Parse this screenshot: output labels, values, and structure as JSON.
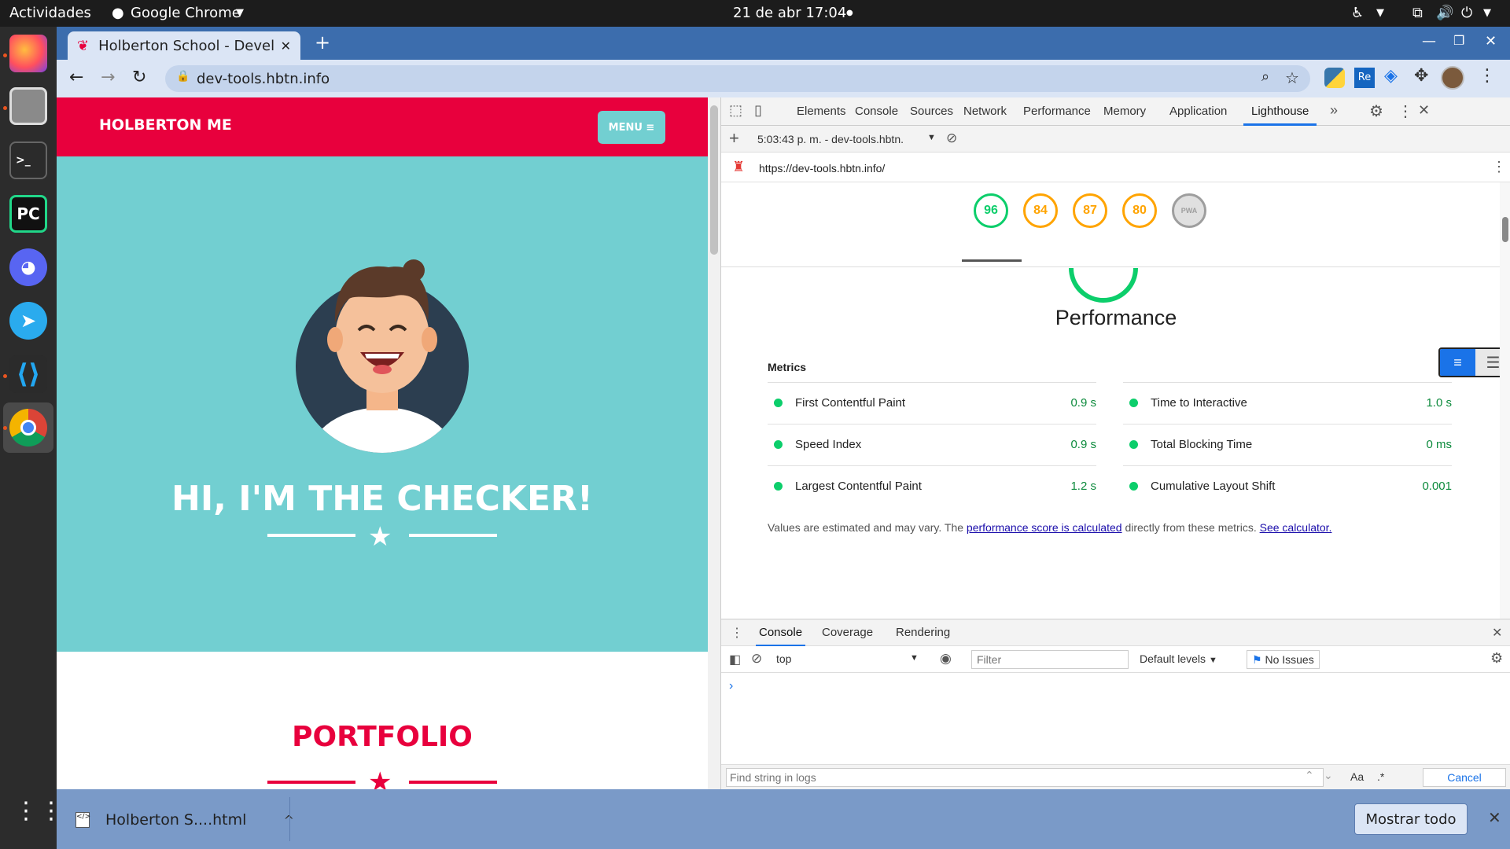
{
  "os": {
    "activities": "Actividades",
    "app_name": "Google Chrome",
    "clock": "21 de abr  17:04"
  },
  "browser": {
    "tab_title": "Holberton School - Devel",
    "url": "dev-tools.hbtn.info"
  },
  "site": {
    "brand": "HOLBERTON ME",
    "menu_label": "MENU ≡",
    "hero_heading": "HI, I'M THE CHECKER!",
    "section_heading": "PORTFOLIO"
  },
  "devtools": {
    "tabs": [
      "Elements",
      "Console",
      "Sources",
      "Network",
      "Performance",
      "Memory",
      "Application",
      "Lighthouse"
    ],
    "active_tab": "Lighthouse",
    "report_selector": "5:03:43 p. m. - dev-tools.hbtn.",
    "report_url": "https://dev-tools.hbtn.info/",
    "scores": [
      {
        "value": "96",
        "color": "#0cce6b"
      },
      {
        "value": "84",
        "color": "#ffa400"
      },
      {
        "value": "87",
        "color": "#ffa400"
      },
      {
        "value": "80",
        "color": "#ffa400"
      },
      {
        "value": "PWA",
        "color": "#9e9e9e"
      }
    ],
    "category_title": "Performance",
    "metrics_title": "Metrics",
    "metrics_left": [
      {
        "label": "First Contentful Paint",
        "value": "0.9 s"
      },
      {
        "label": "Speed Index",
        "value": "0.9 s"
      },
      {
        "label": "Largest Contentful Paint",
        "value": "1.2 s"
      }
    ],
    "metrics_right": [
      {
        "label": "Time to Interactive",
        "value": "1.0 s"
      },
      {
        "label": "Total Blocking Time",
        "value": "0 ms"
      },
      {
        "label": "Cumulative Layout Shift",
        "value": "0.001"
      }
    ],
    "note_prefix": "Values are estimated and may vary. The ",
    "note_link": "performance score is calculated",
    "note_mid": " directly from these metrics. ",
    "note_link2": "See calculator.",
    "drawer_tabs": [
      "Console",
      "Coverage",
      "Rendering"
    ],
    "context": "top",
    "filter_placeholder": "Filter",
    "levels": "Default levels",
    "issues": "No Issues",
    "find_placeholder": "Find string in logs",
    "match_case": "Aa",
    "regex": ".*",
    "cancel": "Cancel"
  },
  "download": {
    "file": "Holberton S....html",
    "show_all": "Mostrar todo"
  },
  "colors": {
    "brand_red": "#e8003d",
    "hero_teal": "#72cfd1",
    "pass_green": "#0cce6b",
    "average_orange": "#ffa400"
  }
}
